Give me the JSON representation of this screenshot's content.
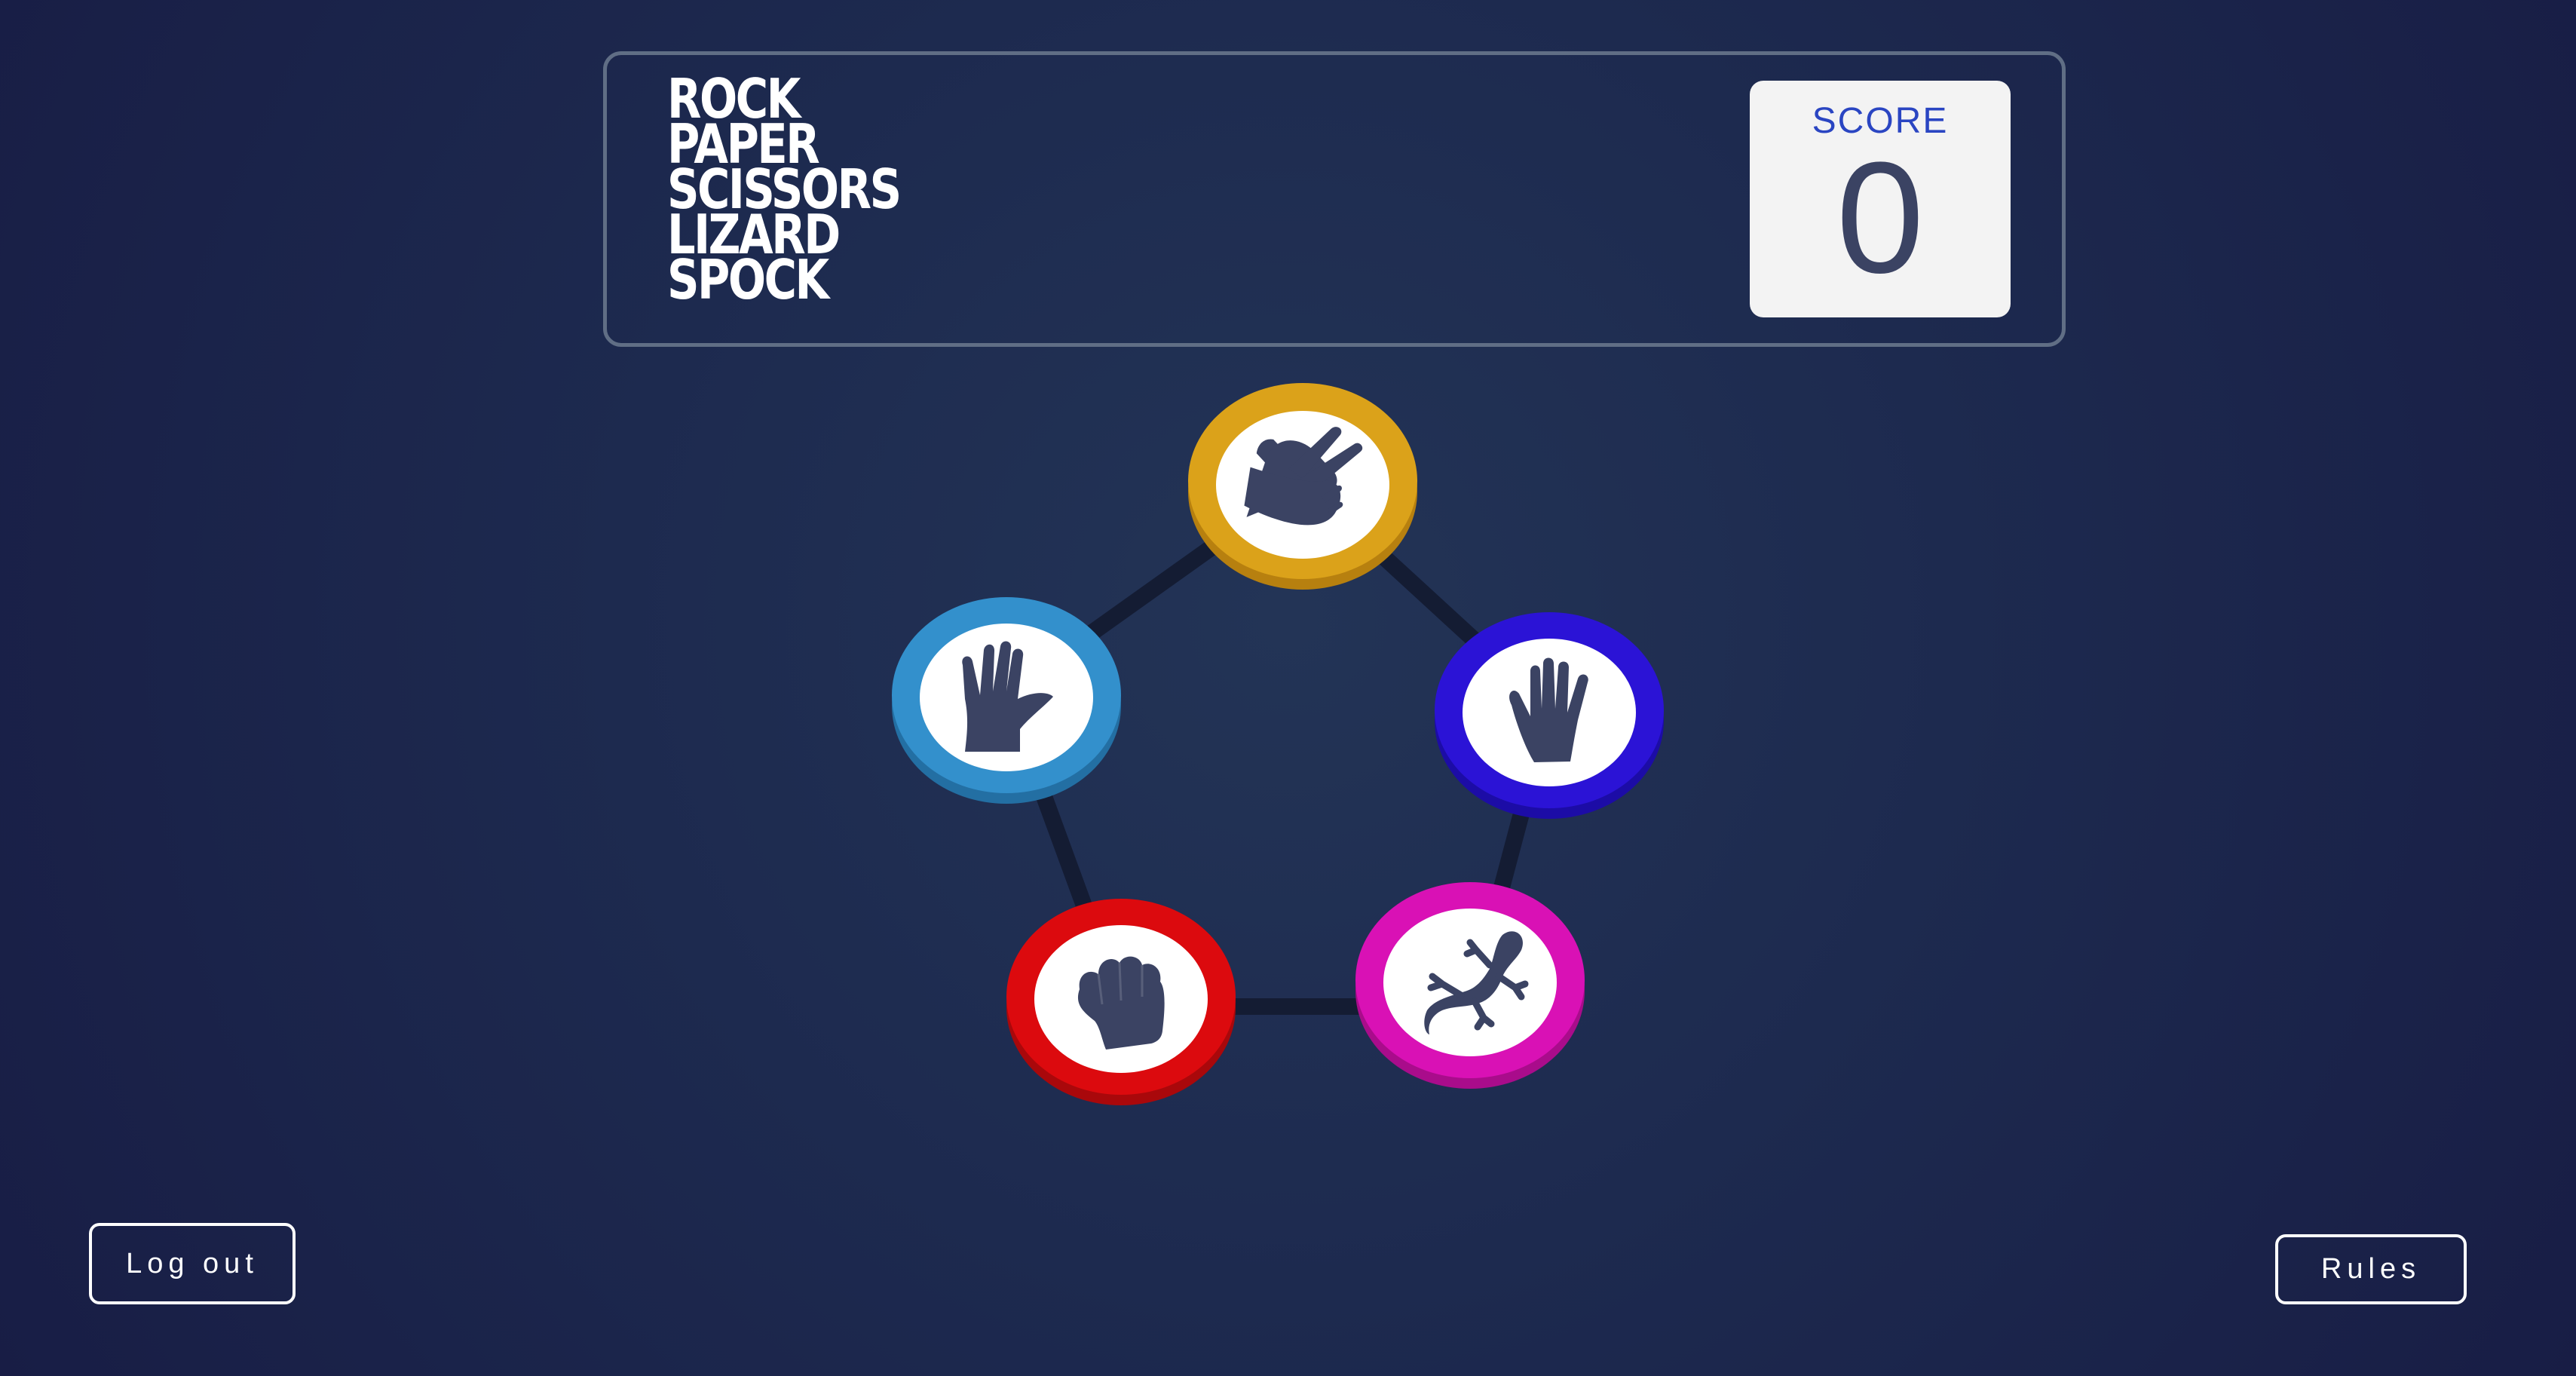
{
  "game": {
    "title_lines": [
      "ROCK",
      "PAPER",
      "SCISSORS",
      "LIZARD",
      "SPOCK"
    ],
    "score": {
      "label": "SCORE",
      "value": "0"
    },
    "choices": [
      {
        "id": "scissors",
        "color": "#dba21a",
        "shadow": "#b7800f"
      },
      {
        "id": "paper",
        "color": "#2b13d6",
        "shadow": "#1c0ca6"
      },
      {
        "id": "lizard",
        "color": "#d911b5",
        "shadow": "#a90c8b"
      },
      {
        "id": "rock",
        "color": "#dc0a0e",
        "shadow": "#a9080b"
      },
      {
        "id": "spock",
        "color": "#3390cc",
        "shadow": "#236fa3"
      }
    ],
    "icon_color": "#3b4363"
  },
  "buttons": {
    "logout_label": "Log out",
    "rules_label": "Rules"
  }
}
